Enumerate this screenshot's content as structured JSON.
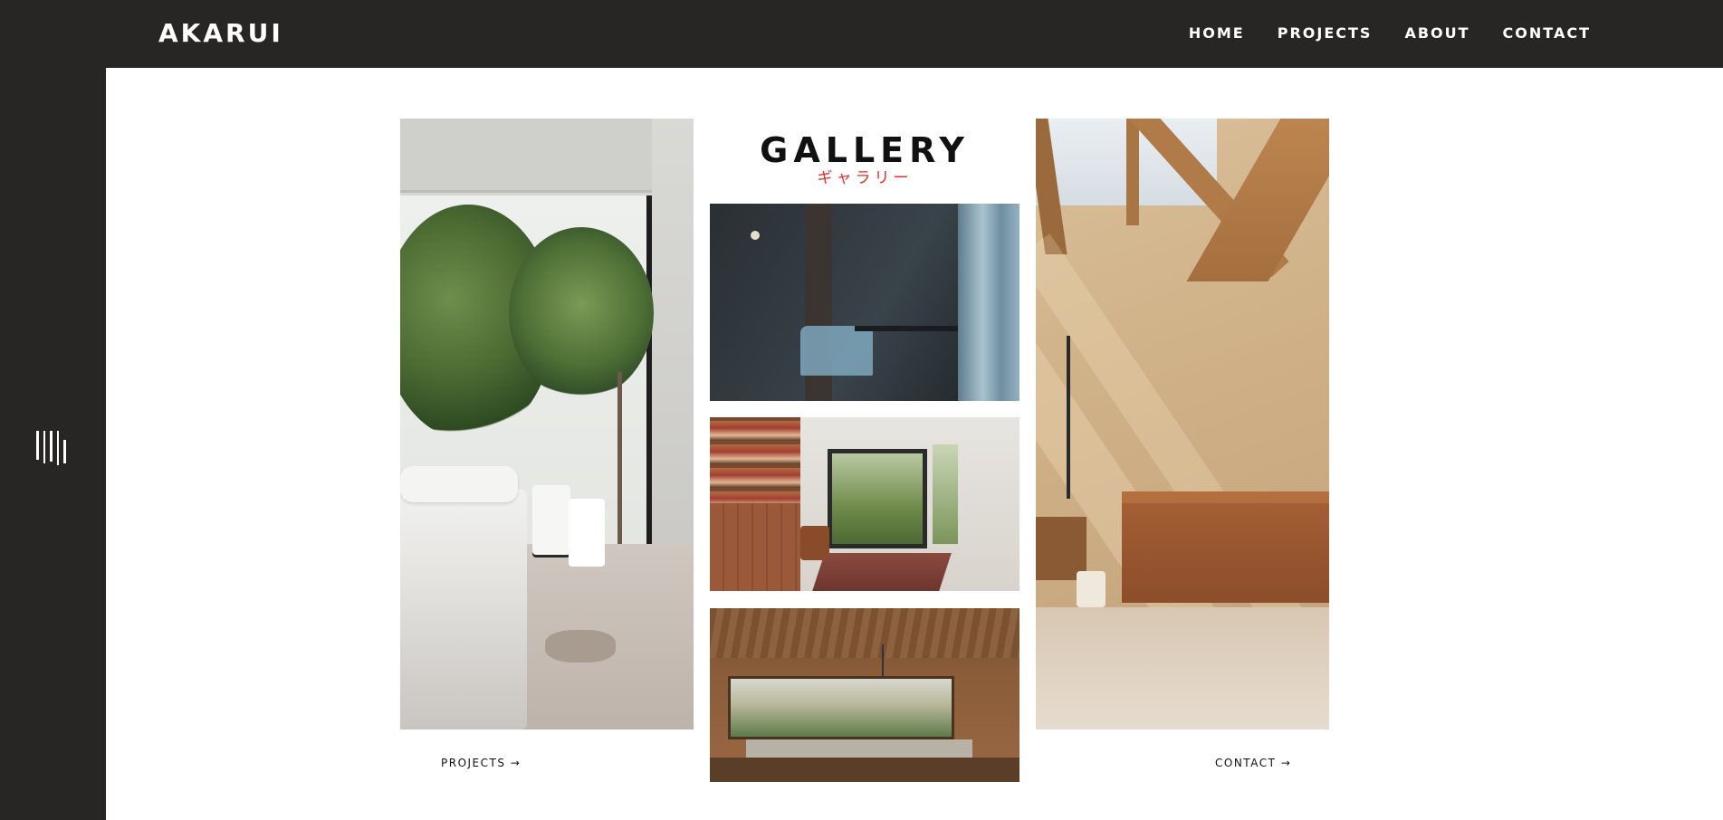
{
  "header": {
    "logo": "AKARUI",
    "nav": [
      "HOME",
      "PROJECTS",
      "ABOUT",
      "CONTACT"
    ]
  },
  "side": {
    "menu_icon": "vertical-lines-menu-icon"
  },
  "gallery": {
    "title": "GALLERY",
    "subtitle": "ギャラリー"
  },
  "links": {
    "projects": "PROJECTS →",
    "contact": "CONTACT →"
  },
  "colors": {
    "dark": "#282624",
    "accent_red": "#e0302a",
    "white": "#ffffff"
  }
}
